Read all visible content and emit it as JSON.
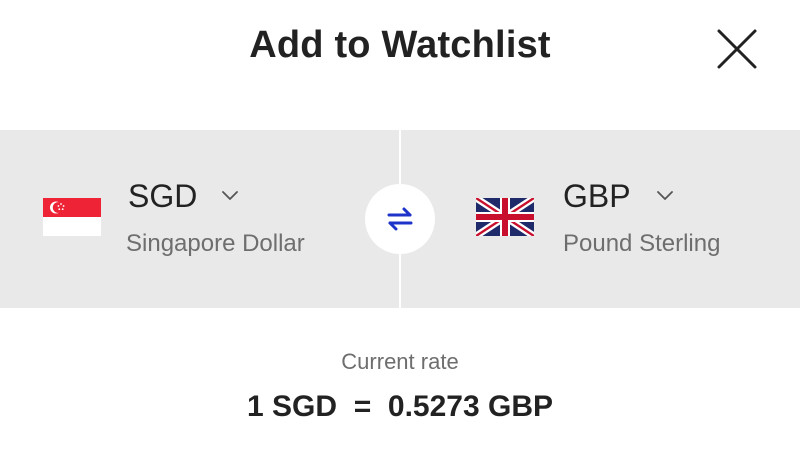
{
  "header": {
    "title": "Add to Watchlist",
    "close_icon": "close-icon"
  },
  "from_currency": {
    "code": "SGD",
    "name": "Singapore Dollar",
    "flag_icon": "singapore-flag-icon",
    "dropdown_icon": "chevron-down-icon"
  },
  "to_currency": {
    "code": "GBP",
    "name": "Pound Sterling",
    "flag_icon": "uk-flag-icon",
    "dropdown_icon": "chevron-down-icon"
  },
  "swap": {
    "icon": "swap-arrows-icon"
  },
  "rate": {
    "label": "Current rate",
    "value": "1 SGD  =  0.5273 GBP"
  },
  "colors": {
    "panel_background": "#e9e9e9",
    "swap_arrows": "#1d33c9",
    "singapore_red": "#ee2436",
    "uk_blue": "#1f2a6b",
    "uk_red": "#c8102e",
    "secondary_text": "#6e6e6e"
  }
}
